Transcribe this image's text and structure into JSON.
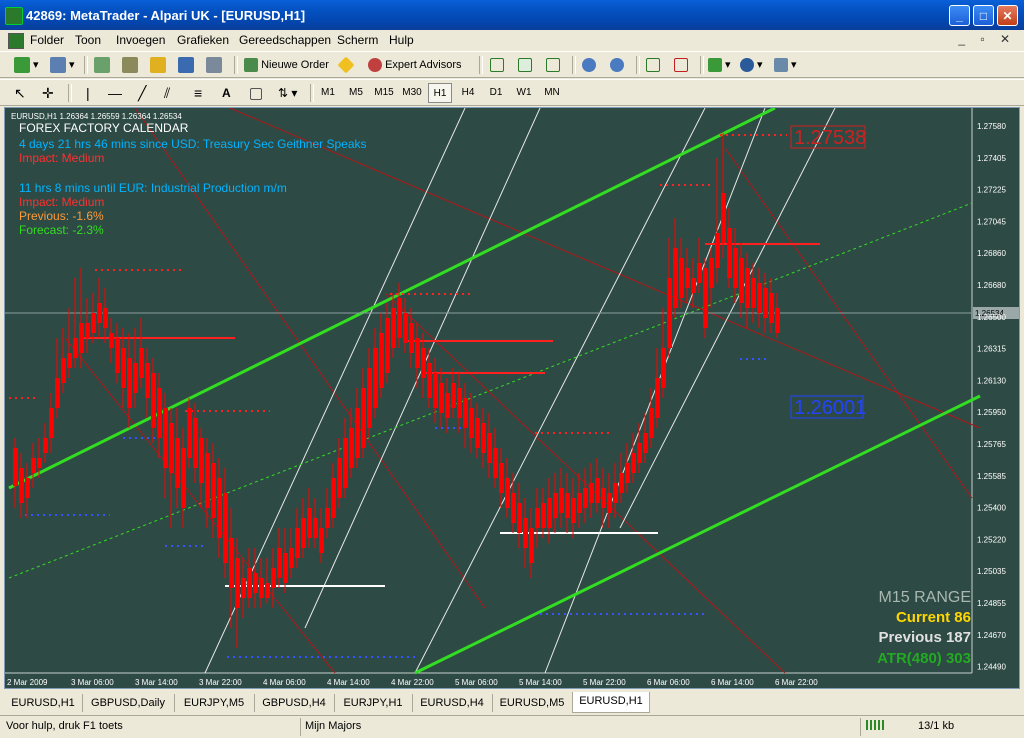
{
  "window": {
    "title": "42869: MetaTrader - Alpari UK - [EURUSD,H1]",
    "minimize": "_",
    "maximize": "□",
    "close": "✕"
  },
  "menu": [
    "Folder",
    "Toon",
    "Invoegen",
    "Grafieken",
    "Gereedschappen",
    "Scherm",
    "Hulp"
  ],
  "toolbar": {
    "new_order": "Nieuwe Order",
    "expert_advisors": "Expert Advisors"
  },
  "drawing_tools": {
    "text_tool": "A"
  },
  "timeframes": [
    {
      "label": "M1",
      "active": false
    },
    {
      "label": "M5",
      "active": false
    },
    {
      "label": "M15",
      "active": false
    },
    {
      "label": "M30",
      "active": false
    },
    {
      "label": "H1",
      "active": true
    },
    {
      "label": "H4",
      "active": false
    },
    {
      "label": "D1",
      "active": false
    },
    {
      "label": "W1",
      "active": false
    },
    {
      "label": "MN",
      "active": false
    }
  ],
  "chart": {
    "header": "EURUSD,H1  1.26364 1.26559 1.26364 1.26534",
    "ff_title": "FOREX FACTORY CALENDAR",
    "ff_line1": "4 days 21 hrs 46 mins since USD: Treasury Sec Geithner Speaks",
    "ff_impact1": "Impact: Medium",
    "ff_line2": "11 hrs 8 mins until EUR: Industrial Production m/m",
    "ff_impact2": "Impact: Medium",
    "ff_previous": "Previous: -1.6%",
    "ff_forecast": "Forecast: -2.3%",
    "label_high": "1.27538",
    "label_low": "1.26001",
    "current_price": "1.26534",
    "range_title": "M15 RANGE",
    "range_current": "Current 86",
    "range_previous": "Previous 187",
    "range_atr": "ATR(480) 303",
    "y_axis": [
      "1.27580",
      "1.27405",
      "1.27225",
      "1.27045",
      "1.26860",
      "1.26680",
      "1.26500",
      "1.26315",
      "1.26130",
      "1.25950",
      "1.25765",
      "1.25585",
      "1.25400",
      "1.25220",
      "1.25035",
      "1.24855",
      "1.24670",
      "1.24490"
    ],
    "x_axis": [
      "2 Mar 2009",
      "3 Mar 06:00",
      "3 Mar 14:00",
      "3 Mar 22:00",
      "4 Mar 06:00",
      "4 Mar 14:00",
      "4 Mar 22:00",
      "5 Mar 06:00",
      "5 Mar 14:00",
      "5 Mar 22:00",
      "6 Mar 06:00",
      "6 Mar 14:00",
      "6 Mar 22:00"
    ],
    "colors": {
      "bg": "#2E4A44",
      "bull": "#FFFFFF",
      "bear": "#FF0000",
      "channel": "#33DD22",
      "high_box": "#FF2020",
      "low_box": "#2244FF",
      "current": "#FFD700",
      "previous": "#E0E0E0",
      "atr": "#22AA22",
      "range_title": "#A8B8B0",
      "ff_title": "#FFFFFF",
      "ff_info": "#00B4FF",
      "ff_impact": "#FF3030",
      "ff_previous": "#FF9A3A",
      "ff_forecast": "#33DD22"
    }
  },
  "tabs": [
    {
      "label": "EURUSD,H1",
      "active": false
    },
    {
      "label": "GBPUSD,Daily",
      "active": false
    },
    {
      "label": "EURJPY,M5",
      "active": false
    },
    {
      "label": "GBPUSD,H4",
      "active": false
    },
    {
      "label": "EURJPY,H1",
      "active": false
    },
    {
      "label": "EURUSD,H4",
      "active": false
    },
    {
      "label": "EURUSD,M5",
      "active": false
    },
    {
      "label": "EURUSD,H1",
      "active": true
    }
  ],
  "status": {
    "help": "Voor hulp, druk F1 toets",
    "profile": "Mijn Majors",
    "traffic": "13/1 kb"
  }
}
